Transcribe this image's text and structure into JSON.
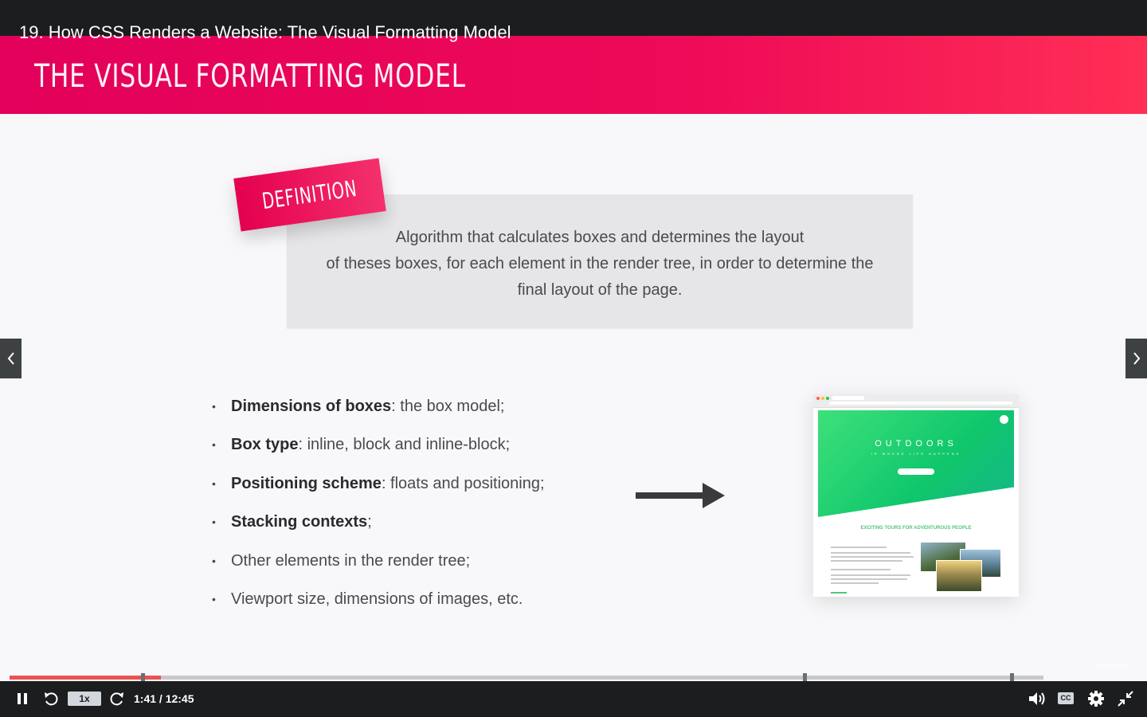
{
  "lecture_title": "19. How CSS Renders a Website: The Visual Formatting Model",
  "slide": {
    "heading": "THE VISUAL FORMATTING MODEL",
    "definition_tag": "DEFINITION",
    "definition_lines": [
      "Algorithm that calculates boxes and determines the layout",
      "of theses boxes, for each element in the render tree, in order to determine the",
      "final layout of the page."
    ],
    "bullets": [
      {
        "bold": "Dimensions of boxes",
        "rest": ": the box model;"
      },
      {
        "bold": "Box type",
        "rest": ": inline, block and inline-block;"
      },
      {
        "bold": "Positioning scheme",
        "rest": ": floats and positioning;"
      },
      {
        "bold": "Stacking contexts",
        "rest": ";"
      },
      {
        "bold": "",
        "rest": "Other elements in the render tree;"
      },
      {
        "bold": "",
        "rest": "Viewport size, dimensions of images, etc."
      }
    ],
    "preview": {
      "brand": "OUTDOORS",
      "tagline": "IS WHERE LIFE HAPPENS",
      "section_heading": "EXCITING TOURS FOR ADVENTUROUS PEOPLE"
    }
  },
  "player": {
    "speed": "1x",
    "time": "1:41 / 12:45",
    "progress": 0.146,
    "chapter_markers": [
      0.129,
      0.769,
      0.969
    ],
    "cc_label": "CC",
    "watermark": "Udemy"
  },
  "colors": {
    "accent": "#ec5252",
    "banner": "#e6005a",
    "preview_green": "#55c57a"
  }
}
